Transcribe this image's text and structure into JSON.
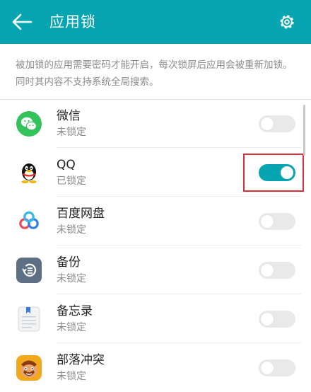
{
  "header": {
    "title": "应用锁",
    "back_icon": "arrow-left-icon",
    "settings_icon": "gear-icon",
    "background_color": "#07a5b1"
  },
  "notice": "被加锁的应用需要密码才能开启，每次锁屏后应用会被重新加锁。同时其内容不支持系统全局搜索。",
  "apps": [
    {
      "name": "微信",
      "status": "未锁定",
      "locked": false,
      "icon": "wechat-icon"
    },
    {
      "name": "QQ",
      "status": "已锁定",
      "locked": true,
      "icon": "qq-penguin-icon"
    },
    {
      "name": "百度网盘",
      "status": "未锁定",
      "locked": false,
      "icon": "baidu-netdisk-icon"
    },
    {
      "name": "备份",
      "status": "未锁定",
      "locked": false,
      "icon": "backup-icon"
    },
    {
      "name": "备忘录",
      "status": "未锁定",
      "locked": false,
      "icon": "notepad-icon"
    },
    {
      "name": "部落冲突",
      "status": "未锁定",
      "locked": false,
      "icon": "clash-of-clans-icon"
    }
  ],
  "colors": {
    "accent": "#07a5b1",
    "highlight": "#d9313a",
    "switch_off": "#e9e9e9"
  }
}
